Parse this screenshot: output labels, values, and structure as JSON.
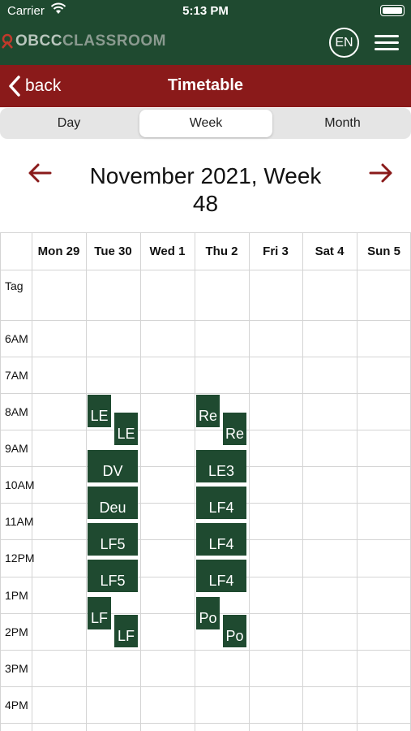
{
  "status_bar": {
    "carrier": "Carrier",
    "time": "5:13 PM"
  },
  "header": {
    "logo_part1": "OBCC",
    "logo_part2": "CLASSROOM",
    "language": "EN",
    "colors": {
      "header_bg": "#1f4a30",
      "nav_bg": "#8a1a1a",
      "event_bg": "#1f4a30"
    }
  },
  "nav": {
    "back_label": "back",
    "title": "Timetable"
  },
  "view_tabs": [
    {
      "label": "Day",
      "active": false
    },
    {
      "label": "Week",
      "active": true
    },
    {
      "label": "Month",
      "active": false
    }
  ],
  "period": {
    "line1": "November 2021, Week",
    "line2": "48",
    "prev_icon": "arrow-left-icon",
    "next_icon": "arrow-right-icon"
  },
  "days": [
    "Mon 29",
    "Tue 30",
    "Wed 1",
    "Thu 2",
    "Fri 3",
    "Sat 4",
    "Sun 5"
  ],
  "rows": [
    "Tag",
    "6AM",
    "7AM",
    "8AM",
    "9AM",
    "10AM",
    "11AM",
    "12PM",
    "1PM",
    "2PM",
    "3PM",
    "4PM"
  ],
  "events": [
    {
      "day": "Tue 30",
      "label": "LE"
    },
    {
      "day": "Tue 30",
      "label": "LE"
    },
    {
      "day": "Tue 30",
      "label": "DV"
    },
    {
      "day": "Tue 30",
      "label": "Deu"
    },
    {
      "day": "Tue 30",
      "label": "LF5"
    },
    {
      "day": "Tue 30",
      "label": "LF5"
    },
    {
      "day": "Tue 30",
      "label": "LF"
    },
    {
      "day": "Tue 30",
      "label": "LF"
    },
    {
      "day": "Thu 2",
      "label": "Re"
    },
    {
      "day": "Thu 2",
      "label": "Re"
    },
    {
      "day": "Thu 2",
      "label": "LE3"
    },
    {
      "day": "Thu 2",
      "label": "LF4"
    },
    {
      "day": "Thu 2",
      "label": "LF4"
    },
    {
      "day": "Thu 2",
      "label": "LF4"
    },
    {
      "day": "Thu 2",
      "label": "Po"
    },
    {
      "day": "Thu 2",
      "label": "Po"
    }
  ]
}
